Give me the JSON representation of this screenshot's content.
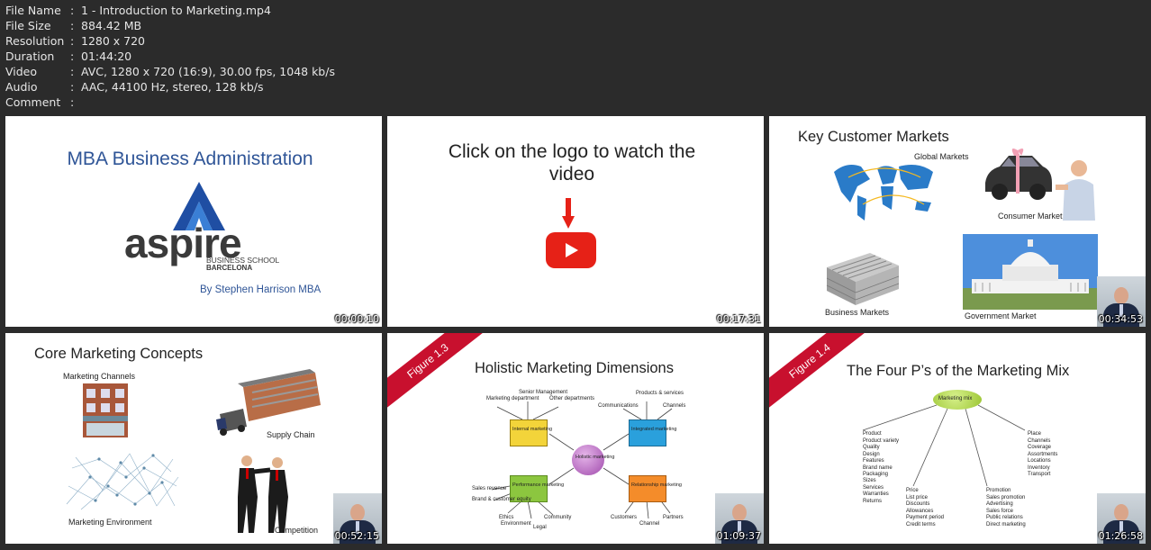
{
  "file_info": [
    {
      "key": "File Name",
      "value": "1 - Introduction to Marketing.mp4"
    },
    {
      "key": "File Size",
      "value": "884.42 MB"
    },
    {
      "key": "Resolution",
      "value": "1280 x 720"
    },
    {
      "key": "Duration",
      "value": "01:44:20"
    },
    {
      "key": "Video",
      "value": "AVC, 1280 x 720 (16:9), 30.00 fps, 1048 kb/s"
    },
    {
      "key": "Audio",
      "value": "AAC, 44100 Hz, stereo, 128 kb/s"
    },
    {
      "key": "Comment",
      "value": ""
    }
  ],
  "separator": ":",
  "thumbs": {
    "t1": {
      "timestamp": "00:00:10",
      "title": "MBA Business Administration",
      "logo_word": "aspire",
      "logo_line1": "BUSINESS SCHOOL",
      "logo_line2": "BARCELONA",
      "byline": "By Stephen Harrison  MBA"
    },
    "t2": {
      "timestamp": "00:17:31",
      "line1": "Click on the logo to watch the",
      "line2": "video"
    },
    "t3": {
      "timestamp": "00:34:53",
      "title": "Key Customer Markets",
      "global": "Global Markets",
      "consumer": "Consumer Market",
      "business": "Business Markets",
      "government": "Government Market"
    },
    "t4": {
      "timestamp": "00:52:15",
      "title": "Core Marketing Concepts",
      "channels": "Marketing Channels",
      "supply": "Supply Chain",
      "environment": "Marketing Environment",
      "competition": "Competition"
    },
    "t5": {
      "timestamp": "01:09:37",
      "banner": "Figure 1.3",
      "title": "Holistic Marketing Dimensions",
      "center": "Holistic marketing",
      "internal": "Internal marketing",
      "integrated": "Integrated marketing",
      "performance": "Performance marketing",
      "relationship": "Relationship marketing",
      "mkt_dept": "Marketing department",
      "senior_mgmt": "Senior Management",
      "other_depts": "Other departments",
      "communications": "Communications",
      "products": "Products & services",
      "channels": "Channels",
      "sales_revenue": "Sales revenue",
      "brand_equity": "Brand & customer equity",
      "ethics": "Ethics",
      "environment": "Environment",
      "legal": "Legal",
      "community": "Community",
      "customers": "Customers",
      "channel": "Channel",
      "partners": "Partners"
    },
    "t6": {
      "timestamp": "01:26:58",
      "banner": "Figure 1.4",
      "title": "The Four P’s of the Marketing Mix",
      "center": "Marketing mix",
      "product": {
        "head": "Product",
        "items": [
          "Product variety",
          "Quality",
          "Design",
          "Features",
          "Brand name",
          "Packaging",
          "Sizes",
          "Services",
          "Warranties",
          "Returns"
        ]
      },
      "price": {
        "head": "Price",
        "items": [
          "List price",
          "Discounts",
          "Allowances",
          "Payment period",
          "Credit terms"
        ]
      },
      "promotion": {
        "head": "Promotion",
        "items": [
          "Sales promotion",
          "Advertising",
          "Sales force",
          "Public relations",
          "Direct marketing"
        ]
      },
      "place": {
        "head": "Place",
        "items": [
          "Channels",
          "Coverage",
          "Assortments",
          "Locations",
          "Inventory",
          "Transport"
        ]
      }
    }
  },
  "colors": {
    "background": "#2b2b2b",
    "info_text": "#e6e6e6",
    "aspire_blue": "#1f4ea3",
    "title_blue": "#2f5597",
    "youtube_red": "#e62117",
    "banner_red": "#c8102e"
  }
}
